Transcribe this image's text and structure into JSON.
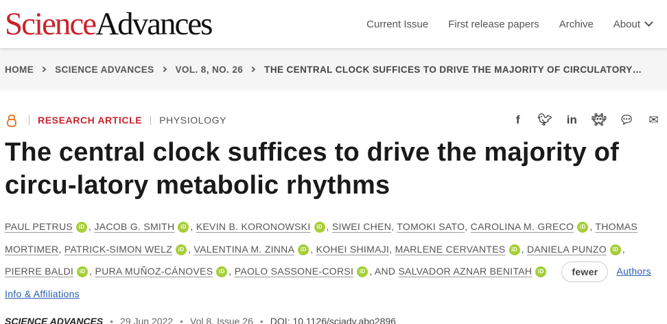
{
  "header": {
    "logo_science": "Science",
    "logo_advances": "Advances",
    "nav": [
      "Current Issue",
      "First release papers",
      "Archive",
      "About"
    ]
  },
  "breadcrumb": [
    "HOME",
    "SCIENCE ADVANCES",
    "VOL. 8, NO. 26",
    "THE CENTRAL CLOCK SUFFICES TO DRIVE THE MAJORITY OF CIRCULATORY…"
  ],
  "article": {
    "type": "RESEARCH ARTICLE",
    "subject": "PHYSIOLOGY",
    "title": "The central clock suffices to drive the majority of circu-latory metabolic rhythms",
    "share_icons": [
      "facebook-icon",
      "twitter-icon",
      "linkedin-icon",
      "reddit-icon",
      "wechat-icon",
      "email-icon"
    ],
    "authors": [
      {
        "name": "PAUL PETRUS",
        "orcid": true
      },
      {
        "name": "JACOB G. SMITH",
        "orcid": true
      },
      {
        "name": "KEVIN B. KORONOWSKI",
        "orcid": true
      },
      {
        "name": "SIWEI CHEN",
        "orcid": false
      },
      {
        "name": "TOMOKI SATO",
        "orcid": false
      },
      {
        "name": "CAROLINA M. GRECO",
        "orcid": true
      },
      {
        "name": "THOMAS MORTIMER",
        "orcid": false
      },
      {
        "name": "PATRICK-SIMON WELZ",
        "orcid": true
      },
      {
        "name": "VALENTINA M. ZINNA",
        "orcid": true
      },
      {
        "name": "KOHEI SHIMAJI",
        "orcid": false
      },
      {
        "name": "MARLENE CERVANTES",
        "orcid": true
      },
      {
        "name": "DANIELA PUNZO",
        "orcid": true
      },
      {
        "name": "PIERRE BALDI",
        "orcid": true
      },
      {
        "name": "PURA MUÑOZ-CÁNOVES",
        "orcid": true
      },
      {
        "name": "PAOLO SASSONE-CORSI",
        "orcid": true
      },
      {
        "name": "SALVADOR AZNAR BENITAH",
        "orcid": true
      }
    ],
    "and_text": "AND",
    "fewer_label": "fewer",
    "affiliations_link": "Authors Info & Affiliations",
    "orcid_label": "iD",
    "journal": "SCIENCE ADVANCES",
    "date": "29 Jun 2022",
    "volume": "Vol 8, Issue 26",
    "doi": "DOI: 10.1126/sciadv.abo2896"
  }
}
